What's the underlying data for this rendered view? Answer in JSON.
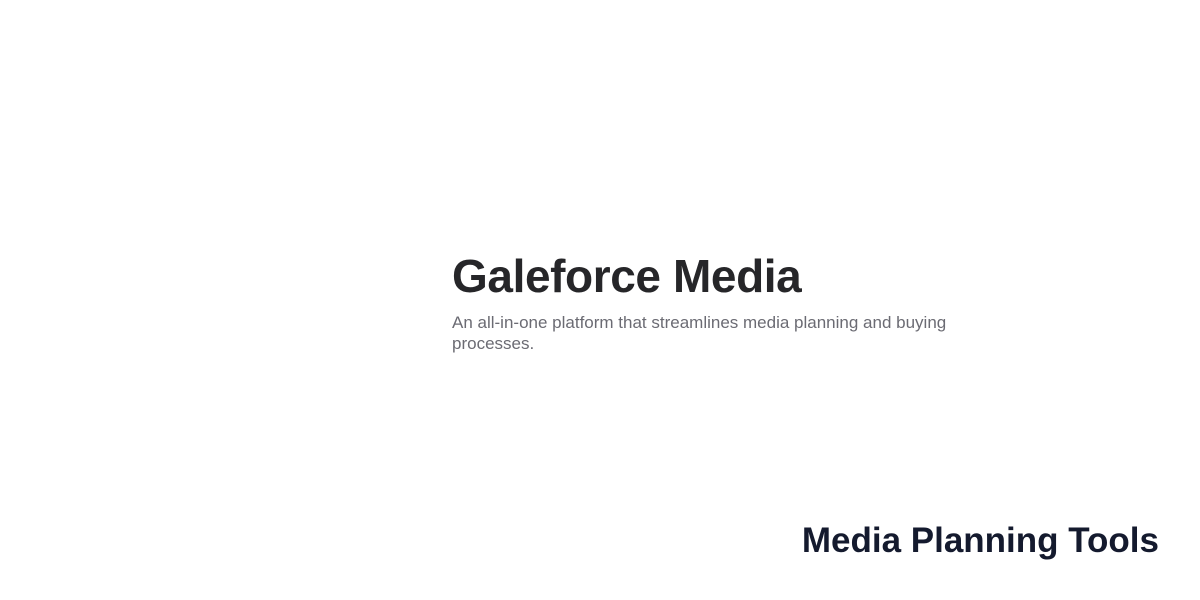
{
  "hero": {
    "title": "Galeforce Media",
    "subtitle": "An all-in-one platform that streamlines media planning and buying processes."
  },
  "footer": {
    "label": "Media Planning Tools"
  },
  "colors": {
    "background": "#ffffff",
    "title": "#262629",
    "subtitle": "#6b6b73",
    "footer_label": "#141a2e"
  }
}
